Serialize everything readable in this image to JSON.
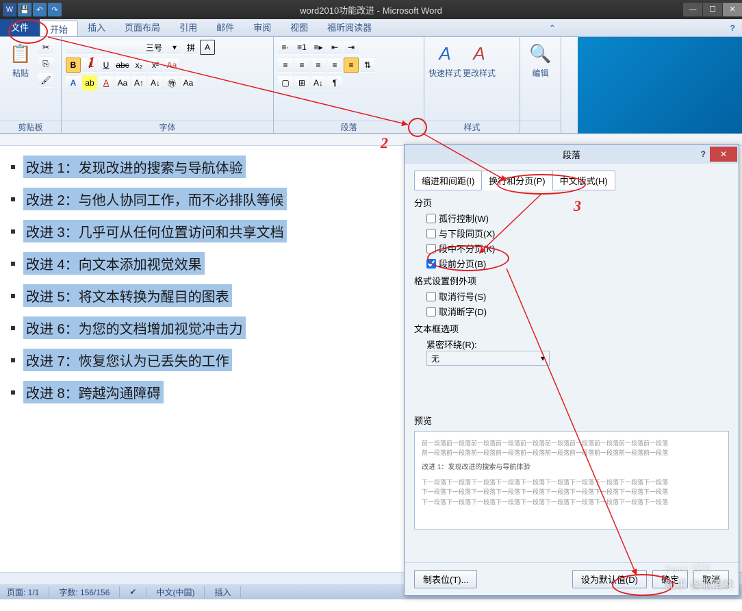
{
  "title": "word2010功能改进 - Microsoft Word",
  "tabs": {
    "file": "文件",
    "home": "开始",
    "insert": "插入",
    "layout": "页面布局",
    "ref": "引用",
    "mail": "邮件",
    "review": "审阅",
    "view": "视图",
    "foxit": "福昕阅读器"
  },
  "groups": {
    "clipboard": "剪贴板",
    "font": "字体",
    "paragraph": "段落",
    "styles": "样式",
    "editing": "编辑"
  },
  "ribbon": {
    "paste": "粘贴",
    "font_size": "三号",
    "quick_style": "快速样式",
    "change_style": "更改样式"
  },
  "doc": {
    "lines": [
      "改进 1：发现改进的搜索与导航体验",
      "改进 2：与他人协同工作，而不必排队等候",
      "改进 3：几乎可从任何位置访问和共享文档",
      "改进 4：向文本添加视觉效果",
      "改进 5：将文本转换为醒目的图表",
      "改进 6：为您的文档增加视觉冲击力",
      "改进 7：恢复您认为已丢失的工作",
      "改进 8：跨越沟通障碍"
    ]
  },
  "status": {
    "page": "页面: 1/1",
    "words": "字数: 156/156",
    "lang": "中文(中国)",
    "insert": "插入"
  },
  "dialog": {
    "title": "段落",
    "tabs": {
      "indent": "缩进和间距(I)",
      "break": "换行和分页(P)",
      "asian": "中文版式(H)"
    },
    "sec_page": "分页",
    "chk_widow": "孤行控制(W)",
    "chk_keepnext": "与下段同页(X)",
    "chk_keeplines": "段中不分页(K)",
    "chk_pagebreak": "段前分页(B)",
    "sec_format": "格式设置例外项",
    "chk_noline": "取消行号(S)",
    "chk_nohyphen": "取消断字(D)",
    "sec_textbox": "文本框选项",
    "tight_wrap": "紧密环绕(R):",
    "tight_val": "无",
    "sec_preview": "预览",
    "preview_emph": "改进 1：发现改进的搜索与导航体验",
    "btn_tabs": "制表位(T)...",
    "btn_default": "设为默认值(D)",
    "btn_ok": "确定",
    "btn_cancel": "取消"
  },
  "annotations": {
    "n1": "1",
    "n2": "2",
    "n3": "3"
  },
  "watermark": {
    "zhihu": "知乎 @张清林",
    "baidu": "Baidu 经验"
  }
}
